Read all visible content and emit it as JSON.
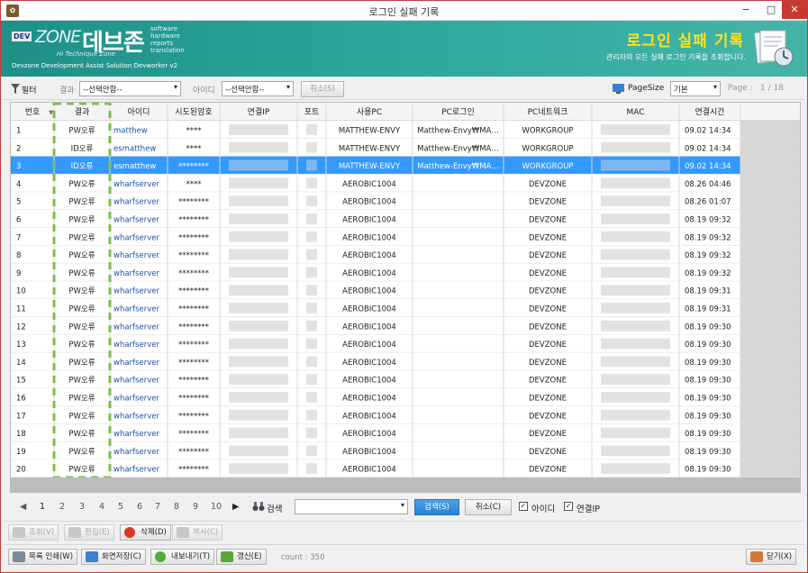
{
  "window": {
    "title": "로그인 실패 기록",
    "minimize": "−",
    "maximize": "□",
    "close": "✕"
  },
  "banner": {
    "logo_dev": "DEV",
    "logo_zone": "ZONE",
    "logo_kr": "데브존",
    "tagline": [
      "software",
      "hardware",
      "reports",
      "translation"
    ],
    "logo_sub": "Hi Technique Zone",
    "footer": "Devzone Development Assist Solution Devworker v2",
    "title": "로그인 실패 기록",
    "description": "관리자의 모든 실패 로그인 기록을 조회합니다."
  },
  "filter": {
    "filter_label": "필터",
    "result_label": "결과",
    "result_value": "--선택안함--",
    "id_label": "아이디",
    "id_value": "--선택안함--",
    "cancel_label": "취소(S)",
    "pagesize_label": "PageSize",
    "pagesize_value": "기본",
    "page_label": "Page :",
    "page_value": "1  / 18"
  },
  "table": {
    "columns": [
      "번호",
      "결과",
      "아이디",
      "시도된암호",
      "연결IP",
      "포트",
      "사용PC",
      "PC로그인",
      "PC네트워크",
      "MAC",
      "연결시간"
    ],
    "selected_index": 2,
    "rows": [
      [
        "1",
        "PW오류",
        "matthew",
        "****",
        "",
        "",
        "MATTHEW-ENVY",
        "Matthew-Envy₩MA…",
        "WORKGROUP",
        "",
        "09.02 14:34"
      ],
      [
        "2",
        "ID오류",
        "esmatthew",
        "****",
        "",
        "",
        "MATTHEW-ENVY",
        "Matthew-Envy₩MA…",
        "WORKGROUP",
        "",
        "09.02 14:34"
      ],
      [
        "3",
        "ID오류",
        "esmatthew",
        "********",
        "",
        "",
        "MATTHEW-ENVY",
        "Matthew-Envy₩MA…",
        "WORKGROUP",
        "",
        "09.02 14:34"
      ],
      [
        "4",
        "PW오류",
        "wharfserver",
        "****",
        "",
        "",
        "AEROBIC1004",
        "",
        "DEVZONE",
        "",
        "08.26 04:46"
      ],
      [
        "5",
        "PW오류",
        "wharfserver",
        "********",
        "",
        "",
        "AEROBIC1004",
        "",
        "DEVZONE",
        "",
        "08.26 01:07"
      ],
      [
        "6",
        "PW오류",
        "wharfserver",
        "********",
        "",
        "",
        "AEROBIC1004",
        "",
        "DEVZONE",
        "",
        "08.19 09:32"
      ],
      [
        "7",
        "PW오류",
        "wharfserver",
        "********",
        "",
        "",
        "AEROBIC1004",
        "",
        "DEVZONE",
        "",
        "08.19 09:32"
      ],
      [
        "8",
        "PW오류",
        "wharfserver",
        "********",
        "",
        "",
        "AEROBIC1004",
        "",
        "DEVZONE",
        "",
        "08.19 09:32"
      ],
      [
        "9",
        "PW오류",
        "wharfserver",
        "********",
        "",
        "",
        "AEROBIC1004",
        "",
        "DEVZONE",
        "",
        "08.19 09:32"
      ],
      [
        "10",
        "PW오류",
        "wharfserver",
        "********",
        "",
        "",
        "AEROBIC1004",
        "",
        "DEVZONE",
        "",
        "08.19 09:31"
      ],
      [
        "11",
        "PW오류",
        "wharfserver",
        "********",
        "",
        "",
        "AEROBIC1004",
        "",
        "DEVZONE",
        "",
        "08.19 09:31"
      ],
      [
        "12",
        "PW오류",
        "wharfserver",
        "********",
        "",
        "",
        "AEROBIC1004",
        "",
        "DEVZONE",
        "",
        "08.19 09:30"
      ],
      [
        "13",
        "PW오류",
        "wharfserver",
        "********",
        "",
        "",
        "AEROBIC1004",
        "",
        "DEVZONE",
        "",
        "08.19 09:30"
      ],
      [
        "14",
        "PW오류",
        "wharfserver",
        "********",
        "",
        "",
        "AEROBIC1004",
        "",
        "DEVZONE",
        "",
        "08.19 09:30"
      ],
      [
        "15",
        "PW오류",
        "wharfserver",
        "********",
        "",
        "",
        "AEROBIC1004",
        "",
        "DEVZONE",
        "",
        "08.19 09:30"
      ],
      [
        "16",
        "PW오류",
        "wharfserver",
        "********",
        "",
        "",
        "AEROBIC1004",
        "",
        "DEVZONE",
        "",
        "08.19 09:30"
      ],
      [
        "17",
        "PW오류",
        "wharfserver",
        "********",
        "",
        "",
        "AEROBIC1004",
        "",
        "DEVZONE",
        "",
        "08.19 09:30"
      ],
      [
        "18",
        "PW오류",
        "wharfserver",
        "********",
        "",
        "",
        "AEROBIC1004",
        "",
        "DEVZONE",
        "",
        "08.19 09:30"
      ],
      [
        "19",
        "PW오류",
        "wharfserver",
        "********",
        "",
        "",
        "AEROBIC1004",
        "",
        "DEVZONE",
        "",
        "08.19 09:30"
      ],
      [
        "20",
        "PW오류",
        "wharfserver",
        "********",
        "",
        "",
        "AEROBIC1004",
        "",
        "DEVZONE",
        "",
        "08.19 09:30"
      ]
    ]
  },
  "pager": {
    "pages": [
      "1",
      "2",
      "3",
      "4",
      "5",
      "6",
      "7",
      "8",
      "9",
      "10"
    ],
    "search_label": "검색",
    "search_button": "검색(S)",
    "cancel_button": "취소(C)",
    "chk_id_label": "아이디",
    "chk_ip_label": "연결IP"
  },
  "actions": {
    "query": "조회(V)",
    "edit": "편집(E)",
    "delete": "삭제(D)",
    "copy": "복사(C)",
    "print_list": "목록 인쇄(W)",
    "save_screen": "화면저장(C)",
    "export": "내보내기(T)",
    "refresh": "갱신(E)",
    "count": "count : 350",
    "close": "닫기(X)"
  },
  "colors": {
    "banner": "#2aa69c",
    "selected_row": "#3399ff",
    "banner_title": "#ffe21a",
    "close": "#c7382f",
    "link": "#1a4fa8"
  }
}
